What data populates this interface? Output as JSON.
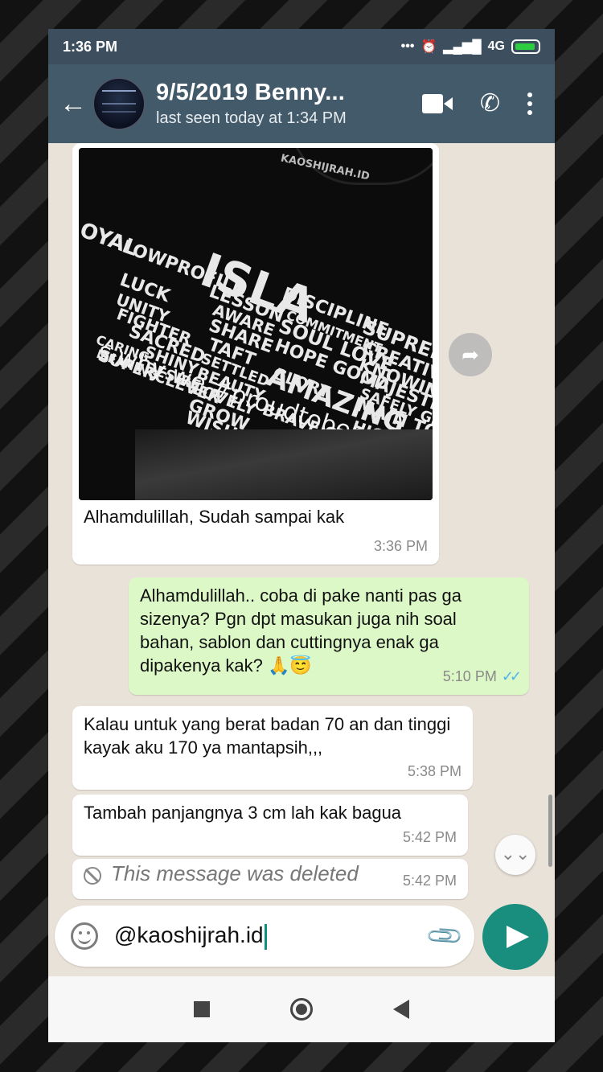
{
  "status_bar": {
    "time": "1:36 PM",
    "network": "4G"
  },
  "header": {
    "contact_name": "9/5/2019 Benny...",
    "last_seen": "last seen today at 1:34 PM"
  },
  "messages": [
    {
      "direction": "incoming",
      "type": "image",
      "caption": "Alhamdulillah, Sudah sampai kak",
      "time": "3:36 PM",
      "image_text": {
        "tagline": "s why we #proudtobemusli",
        "brand": "KAOSHIJRAH.ID"
      }
    },
    {
      "direction": "outgoing",
      "text": "Alhamdulillah.. coba di pake nanti pas ga sizenya? Pgn dpt masukan juga nih soal bahan, sablon dan cuttingnya enak ga dipakenya kak? 🙏😇",
      "time": "5:10 PM",
      "read": true
    },
    {
      "direction": "incoming",
      "text": "Kalau untuk yang berat badan 70 an dan tinggi kayak aku 170 ya mantapsih,,,",
      "time": "5:38 PM"
    },
    {
      "direction": "incoming",
      "text": "Tambah panjangnya 3 cm lah kak bagua",
      "time": "5:42 PM"
    },
    {
      "direction": "incoming",
      "deleted": true,
      "text": "This message was deleted",
      "time": "5:42 PM"
    }
  ],
  "composer": {
    "value": "@kaoshijrah.id"
  },
  "colors": {
    "header": "#435a6a",
    "status_bar": "#3d4f5e",
    "outgoing_bubble": "#dcf8c6",
    "send_button": "#1a8e7e",
    "read_ticks": "#4fb6ec"
  }
}
